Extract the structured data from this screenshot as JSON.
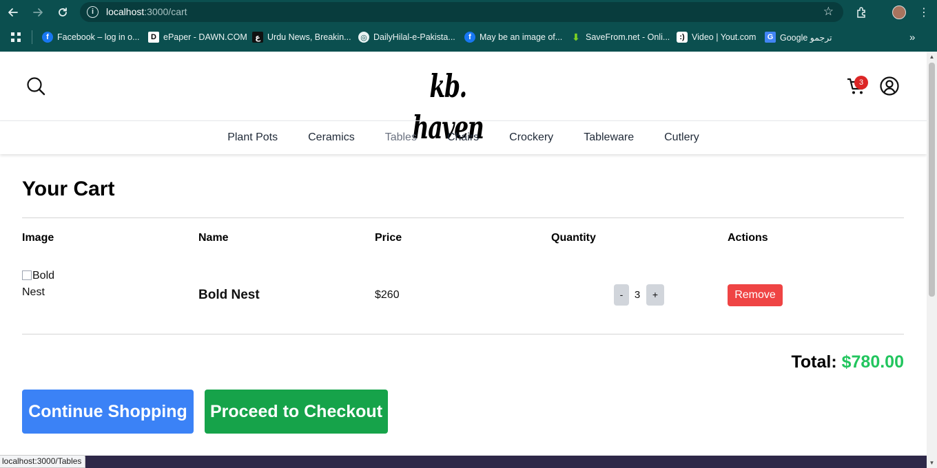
{
  "browser": {
    "url_host": "localhost",
    "url_path": ":3000/cart",
    "bookmarks": [
      {
        "label": "Facebook – log in o...",
        "icon": "facebook-icon"
      },
      {
        "label": "ePaper - DAWN.COM",
        "icon": "dawn-icon"
      },
      {
        "label": "Urdu News, Breakin...",
        "icon": "urdu-news-icon"
      },
      {
        "label": "DailyHilal-e-Pakista...",
        "icon": "globe-icon"
      },
      {
        "label": "May be an image of...",
        "icon": "facebook-icon"
      },
      {
        "label": "SaveFrom.net - Onli...",
        "icon": "download-icon"
      },
      {
        "label": "Video | Yout.com",
        "icon": "yout-icon"
      },
      {
        "label": "Google ترجمو",
        "icon": "google-translate-icon"
      }
    ],
    "status_url": "localhost:3000/Tables"
  },
  "site": {
    "logo": "kb. haven",
    "cart_count": "3",
    "nav": [
      "Plant Pots",
      "Ceramics",
      "Tables",
      "Chairs",
      "Crockery",
      "Tableware",
      "Cutlery"
    ],
    "active_nav": "Tables"
  },
  "cart": {
    "title": "Your Cart",
    "headers": {
      "image": "Image",
      "name": "Name",
      "price": "Price",
      "quantity": "Quantity",
      "actions": "Actions"
    },
    "items": [
      {
        "image_alt": "Bold Nest",
        "name": "Bold Nest",
        "price": "$260",
        "quantity": "3",
        "minus": "-",
        "plus": "+",
        "remove": "Remove"
      }
    ],
    "total_label": "Total:",
    "total_value": "$780.00",
    "continue_label": "Continue Shopping",
    "checkout_label": "Proceed to Checkout"
  },
  "colors": {
    "chrome": "#0b4f4f",
    "remove": "#ef4444",
    "continue": "#3b82f6",
    "checkout": "#16a34a",
    "total": "#22c55e",
    "badge": "#dc2626"
  }
}
